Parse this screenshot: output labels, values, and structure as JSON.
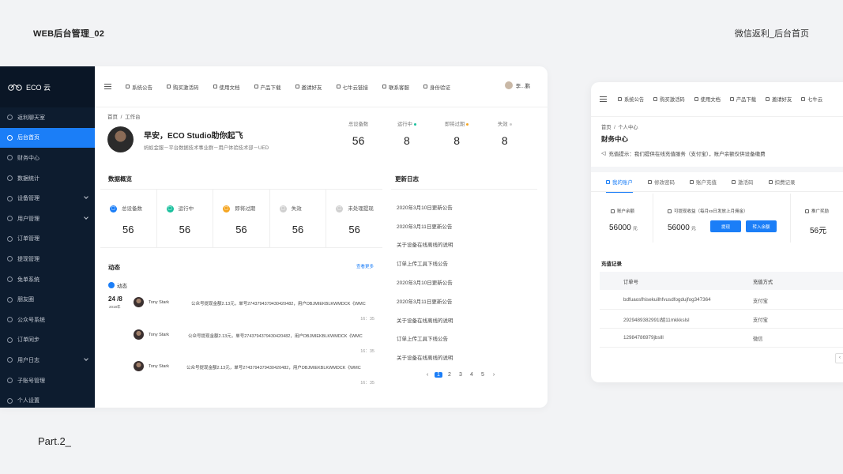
{
  "presentation": {
    "header_left": "WEB后台管理_02",
    "header_right": "微信返利_后台首页",
    "footer": "Part.2_"
  },
  "app": {
    "logo": "ECO 云"
  },
  "sidebar": {
    "items": [
      {
        "label": "返利聊天室"
      },
      {
        "label": "后台首页"
      },
      {
        "label": "财务中心"
      },
      {
        "label": "数据统计"
      },
      {
        "label": "设备管理"
      },
      {
        "label": "用户管理"
      },
      {
        "label": "订单管理"
      },
      {
        "label": "提现管理"
      },
      {
        "label": "免单系统"
      },
      {
        "label": "朋友圈"
      },
      {
        "label": "公众号系统"
      },
      {
        "label": "订单同步"
      },
      {
        "label": "用户日志"
      },
      {
        "label": "子账号管理"
      },
      {
        "label": "个人设置"
      }
    ]
  },
  "topnav": {
    "items": [
      "系统公告",
      "购买激活码",
      "使用文档",
      "产品下载",
      "邀请好友",
      "七牛云链接",
      "联系客服",
      "身份验证"
    ],
    "user": "李...鹏"
  },
  "breadcrumb": {
    "home": "首页",
    "sep": "/",
    "current": "工作台"
  },
  "profile": {
    "greeting": "早安，ECO Studio助你起飞",
    "subtitle": "蚂蚁金服－平台数据技术事业群－用户体验技术部－UED"
  },
  "stats": [
    {
      "label": "总设备数",
      "value": "56"
    },
    {
      "label": "运行中",
      "value": "8"
    },
    {
      "label": "即将过期",
      "value": "8"
    },
    {
      "label": "失效",
      "value": "8"
    }
  ],
  "overview": {
    "title": "数据概览",
    "cards": [
      {
        "label": "总设备数",
        "value": "56"
      },
      {
        "label": "运行中",
        "value": "56"
      },
      {
        "label": "即将过期",
        "value": "56"
      },
      {
        "label": "失效",
        "value": "56"
      },
      {
        "label": "未处理提现",
        "value": "56"
      }
    ]
  },
  "activity": {
    "title": "动态",
    "more": "查看更多",
    "tag": "动态",
    "date_day": "24 /8",
    "date_year": "2018年",
    "items": [
      {
        "name": "Tony Stark",
        "text": "公众号提现金额2.13元，单号274379437943042048​2，用户DBJMIEKBLKWMDCK《WMC",
        "time": "16：35"
      },
      {
        "name": "Tony Stark",
        "text": "公众号提现金额2.13元，单号274379437943042048​2，用户DBJMIEKBLKWMDCK《WMC",
        "time": "16：35"
      },
      {
        "name": "Tony Stark",
        "text": "公众号提现金额2.13元，单号274379437943042048​2，用户DBJMIEKBLKWMDCK《WMC",
        "time": "16：35"
      }
    ]
  },
  "changelog": {
    "title": "更新日志",
    "items": [
      "2020年3月10日更新公告",
      "2020年3月11日更新公告",
      "关于设备在线离线的说明",
      "订单上传工具下线公告",
      "2020年3月10日更新公告",
      "2020年3月11日更新公告",
      "关于设备在线离线的说明",
      "订单上传工具下线公告",
      "关于设备在线离线的说明"
    ],
    "pages": [
      "1",
      "2",
      "3",
      "4",
      "5"
    ],
    "prev": "‹",
    "next": "›"
  },
  "finance": {
    "topnav": [
      "系统公告",
      "购买激活码",
      "使用文档",
      "产品下载",
      "邀请好友",
      "七牛云"
    ],
    "breadcrumb_home": "首页",
    "breadcrumb_current": "个人中心",
    "title": "财务中心",
    "tip": "充值提示：我们提供在线充值服务（支付宝），账户余额仅供设备缴费",
    "tabs": [
      "我的账户",
      "修改密码",
      "账户充值",
      "激活码",
      "扣费记录"
    ],
    "balance_label": "账户余额",
    "balance_value": "56000",
    "balance_unit": "元",
    "withdraw_label": "可提现收益（每月xx日发放上月佣金）",
    "withdraw_value": "56000",
    "withdraw_unit": "元",
    "btn_withdraw": "提现",
    "btn_transfer": "转入余额",
    "reward_label": "推广奖励",
    "reward_value": "56元",
    "records_title": "充值记录",
    "columns": [
      "订单号",
      "充值方式"
    ],
    "rows": [
      {
        "id": "bdfuaosfhisekuilhfvusdfogdujfog347364",
        "method": "支付宝"
      },
      {
        "id": "2929489382991l胡11mkkkslsl",
        "method": "支付宝"
      },
      {
        "id": "12984786979jbslll",
        "method": "微信"
      }
    ],
    "pager_prev": "‹"
  },
  "colors": {
    "primary": "#1b7ef7",
    "sidebar": "#0d1c2f",
    "green": "#1bc09e",
    "orange": "#f5a623"
  }
}
